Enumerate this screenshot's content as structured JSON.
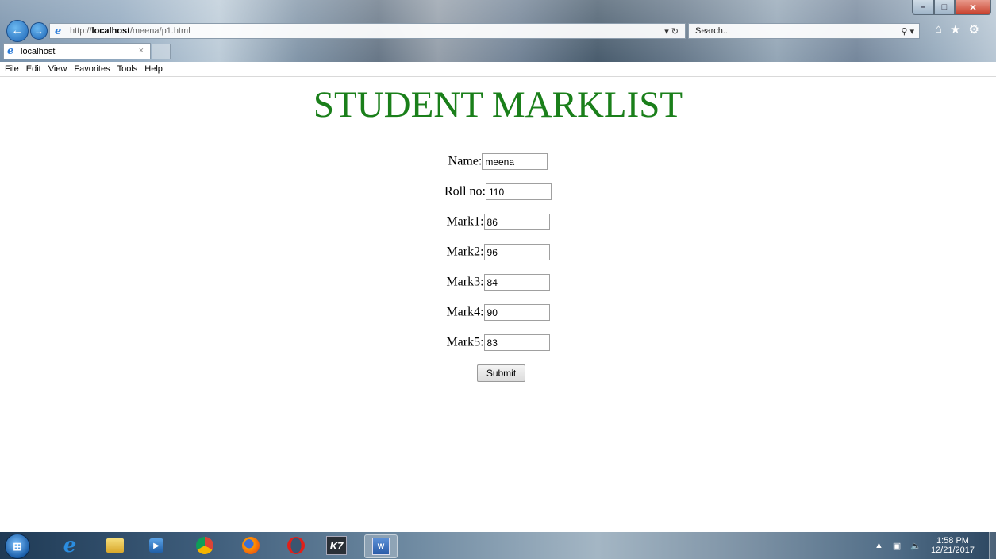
{
  "browser": {
    "url_prefix": "http://",
    "url_host": "localhost",
    "url_path": "/meena/p1.html",
    "refresh_icon": "refresh-icon",
    "search_placeholder": "Search...",
    "tab_title": "localhost",
    "tab_close": "×",
    "menu": [
      "File",
      "Edit",
      "View",
      "Favorites",
      "Tools",
      "Help"
    ]
  },
  "page": {
    "title": "STUDENT MARKLIST",
    "fields": [
      {
        "label": "Name:",
        "value": "meena"
      },
      {
        "label": "Roll no:",
        "value": "110"
      },
      {
        "label": "Mark1:",
        "value": "86"
      },
      {
        "label": "Mark2:",
        "value": "96"
      },
      {
        "label": "Mark3:",
        "value": "84"
      },
      {
        "label": "Mark4:",
        "value": "90"
      },
      {
        "label": "Mark5:",
        "value": "83"
      }
    ],
    "submit_label": "Submit",
    "title_color": "#1a7f1a"
  },
  "taskbar": {
    "apps": [
      "start-orb",
      "internet-explorer",
      "file-explorer",
      "media-player",
      "chrome",
      "firefox",
      "opera",
      "k7-antivirus",
      "microsoft-word"
    ],
    "time": "1:58 PM",
    "date": "12/21/2017"
  }
}
